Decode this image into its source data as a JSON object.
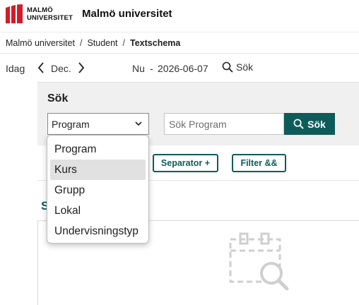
{
  "header": {
    "logo_line1": "MALMÖ",
    "logo_line2": "UNIVERSITET",
    "site_name": "Malmö universitet",
    "brand_color": "#d31c2b"
  },
  "breadcrumb": {
    "items": [
      "Malmö universitet",
      "Student",
      "Textschema"
    ],
    "separator": "/"
  },
  "datebar": {
    "today_label": "Idag",
    "month_label": "Dec.",
    "now_label": "Nu",
    "dash": "-",
    "date": "2026-06-07",
    "search_label": "Sök"
  },
  "search": {
    "title": "Sök",
    "select_value": "Program",
    "input_placeholder": "Sök Program",
    "button_label": "Sök",
    "accent_color": "#0e5c5a"
  },
  "toolbar": {
    "separator_label": "Separator +",
    "filter_label": "Filter &&"
  },
  "results": {
    "heading_fragment": "S",
    "empty_icon": "calendar-search-icon"
  },
  "dropdown": {
    "options": [
      "Program",
      "Kurs",
      "Grupp",
      "Lokal",
      "Undervisningstyp"
    ],
    "highlighted": "Kurs"
  }
}
